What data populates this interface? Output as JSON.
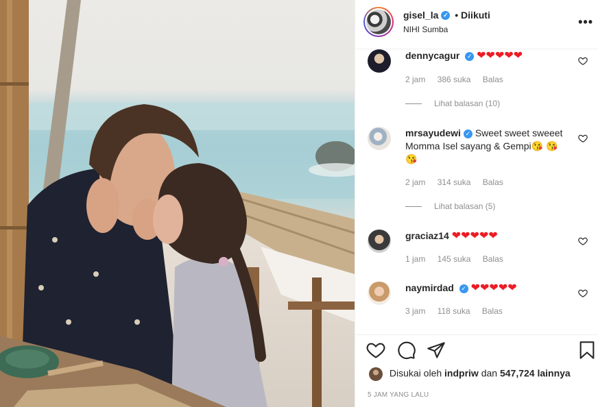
{
  "header": {
    "username": "gisel_la",
    "follow_label": "• Diikuti",
    "location": "NIHI Sumba",
    "verified_mark": "✓",
    "more_label": "•••"
  },
  "comments": [
    {
      "username": "dennycagur",
      "verified": true,
      "text": "❤❤❤❤❤",
      "time": "2 jam",
      "likes": "386 suka",
      "reply_label": "Balas",
      "replies_label": "Lihat balasan (10)"
    },
    {
      "username": "mrsayudewi",
      "verified": true,
      "text": " Sweet sweet sweeet Momma Isel sayang & Gempi😘 😘 😘",
      "time": "2 jam",
      "likes": "314 suka",
      "reply_label": "Balas",
      "replies_label": "Lihat balasan (5)"
    },
    {
      "username": "graciaz14",
      "verified": false,
      "text": "❤❤❤❤❤",
      "time": "1 jam",
      "likes": "145 suka",
      "reply_label": "Balas"
    },
    {
      "username": "naymirdad",
      "verified": true,
      "text": "❤❤❤❤❤",
      "time": "3 jam",
      "likes": "118 suka",
      "reply_label": "Balas"
    }
  ],
  "likes": {
    "prefix": "Disukai oleh",
    "user": "indpriw",
    "middle": "dan",
    "count": "547,724 lainnya"
  },
  "timestamp": "5 JAM YANG LALU",
  "icons": {
    "like": "heart-icon",
    "comment": "comment-icon",
    "share": "share-icon",
    "save": "bookmark-icon",
    "more": "more-icon"
  },
  "colors": {
    "verified_blue": "#3897f0",
    "heart_red": "#ed1c24",
    "meta_gray": "#8e8e8e",
    "text": "#262626"
  }
}
